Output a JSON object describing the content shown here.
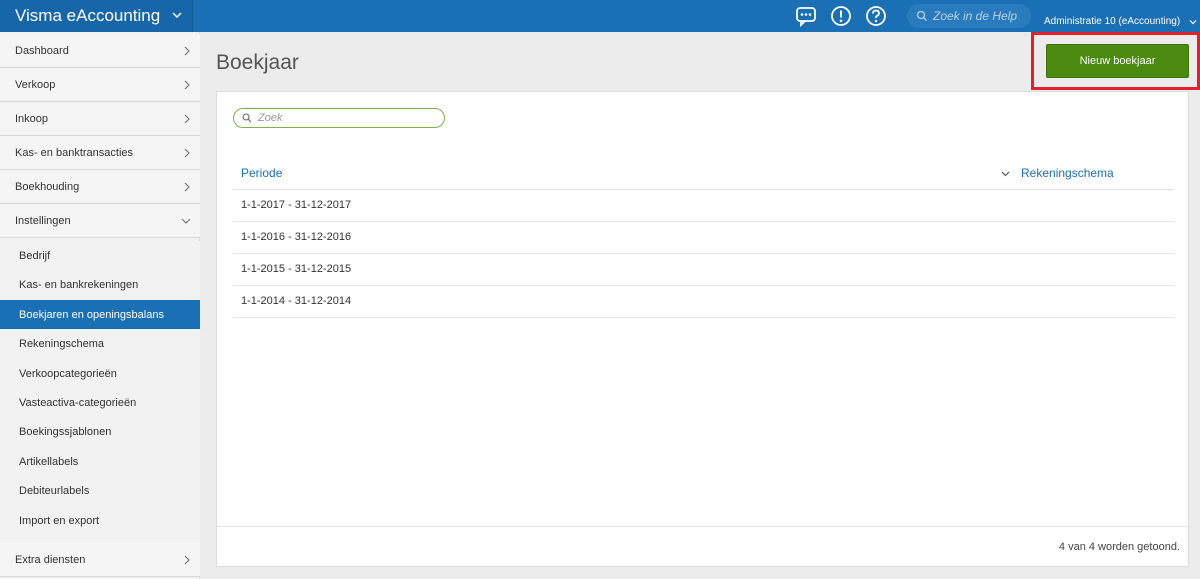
{
  "app": {
    "title": "Visma eAccounting",
    "help_search_placeholder": "Zoek in de Help",
    "administration": "Administratie 10 (eAccounting)"
  },
  "icons": {
    "brand_menu": "chevron-down-icon",
    "chat": "chat-icon",
    "alert": "exclamation-icon",
    "help": "question-icon",
    "search": "search-icon"
  },
  "colors": {
    "topbar": "#1a6fb5",
    "active_nav": "#1a6fb5",
    "primary_button": "#4b8a0e",
    "highlight_box": "#e4202a",
    "link": "#1a6fb5"
  },
  "sidebar": {
    "items": [
      {
        "label": "Dashboard"
      },
      {
        "label": "Verkoop"
      },
      {
        "label": "Inkoop"
      },
      {
        "label": "Kas- en banktransacties"
      },
      {
        "label": "Boekhouding"
      },
      {
        "label": "Instellingen"
      }
    ],
    "sub_items": [
      {
        "label": "Bedrijf"
      },
      {
        "label": "Kas- en bankrekeningen"
      },
      {
        "label": "Boekjaren en openingsbalans"
      },
      {
        "label": "Rekeningschema"
      },
      {
        "label": "Verkoopcategorieën"
      },
      {
        "label": "Vasteactiva-categorieën"
      },
      {
        "label": "Boekingssjablonen"
      },
      {
        "label": "Artikellabels"
      },
      {
        "label": "Debiteurlabels"
      },
      {
        "label": "Import en export"
      }
    ],
    "active_sub_item": "Boekjaren en openingsbalans",
    "bottom_item": {
      "label": "Extra diensten"
    }
  },
  "main": {
    "title": "Boekjaar",
    "new_button": "Nieuw boekjaar",
    "search_placeholder": "Zoek",
    "table": {
      "columns": [
        "Periode",
        "Rekeningschema"
      ],
      "rows": [
        {
          "periode": "1-1-2017 - 31-12-2017",
          "rekeningschema": ""
        },
        {
          "periode": "1-1-2016 - 31-12-2016",
          "rekeningschema": ""
        },
        {
          "periode": "1-1-2015 - 31-12-2015",
          "rekeningschema": ""
        },
        {
          "periode": "1-1-2014 - 31-12-2014",
          "rekeningschema": ""
        }
      ]
    },
    "footer_count": "4 van 4 worden getoond."
  }
}
